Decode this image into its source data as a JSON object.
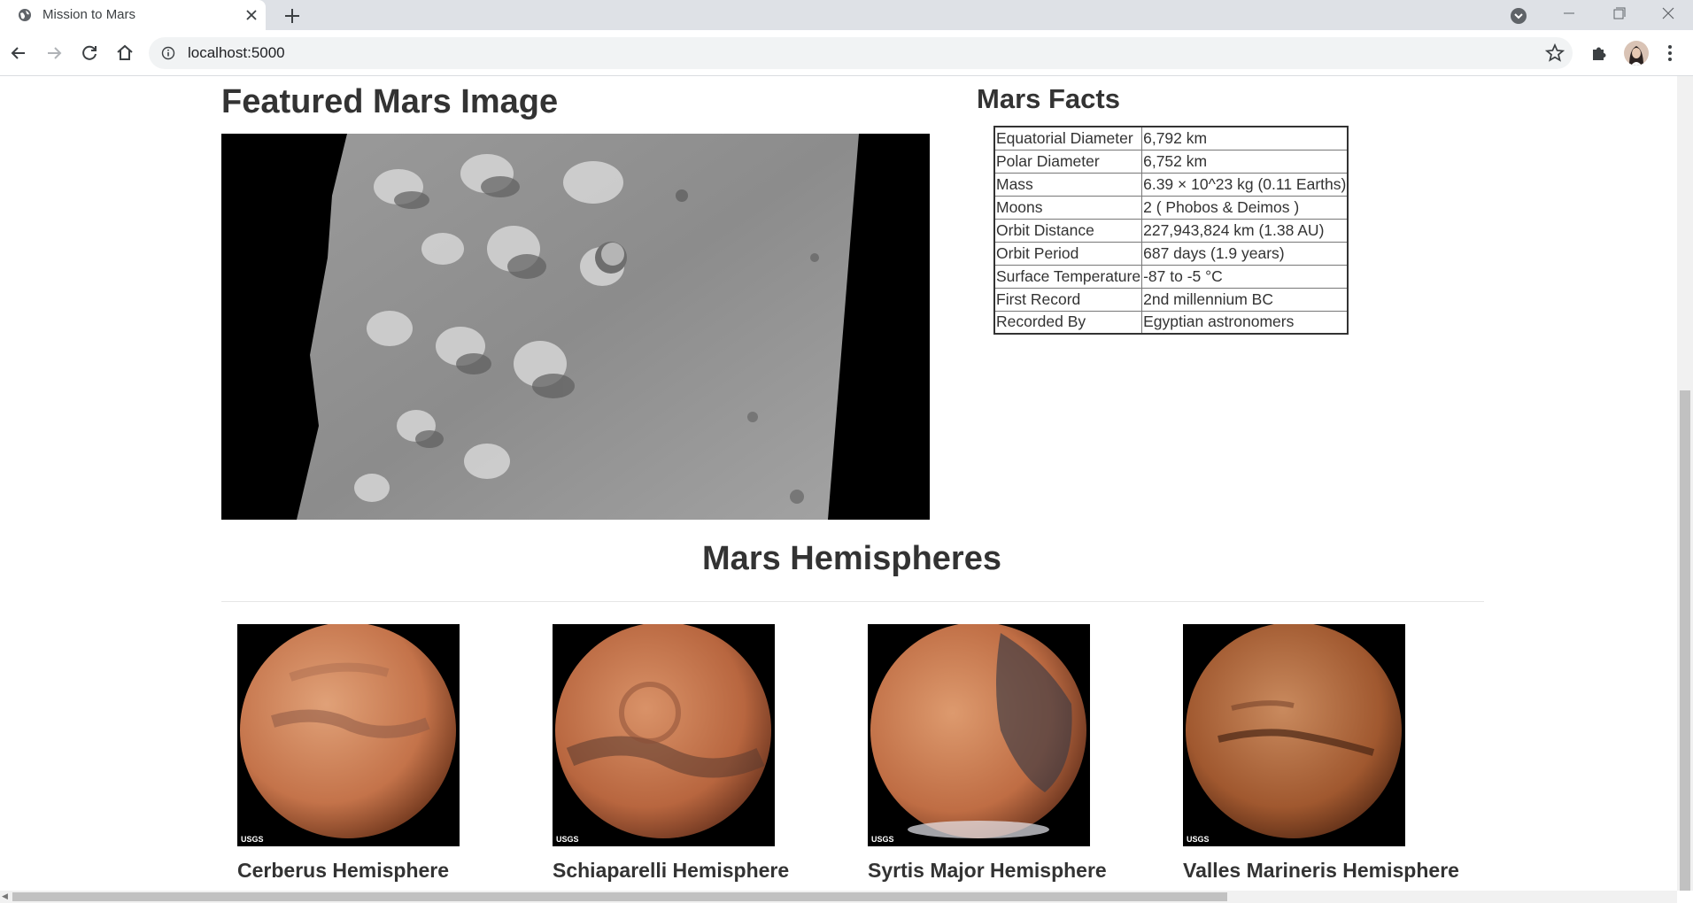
{
  "browser": {
    "tab_title": "Mission to Mars",
    "url": "localhost:5000"
  },
  "featured": {
    "title": "Featured Mars Image"
  },
  "facts": {
    "title": "Mars Facts",
    "rows": [
      {
        "label": "Equatorial Diameter",
        "value": "6,792 km"
      },
      {
        "label": "Polar Diameter",
        "value": "6,752 km"
      },
      {
        "label": "Mass",
        "value": "6.39 × 10^23 kg (0.11 Earths)"
      },
      {
        "label": "Moons",
        "value": "2 ( Phobos & Deimos )"
      },
      {
        "label": "Orbit Distance",
        "value": "227,943,824 km (1.38 AU)"
      },
      {
        "label": "Orbit Period",
        "value": "687 days (1.9 years)"
      },
      {
        "label": "Surface Temperature",
        "value": "-87 to -5 °C"
      },
      {
        "label": "First Record",
        "value": "2nd millennium BC"
      },
      {
        "label": "Recorded By",
        "value": "Egyptian astronomers"
      }
    ]
  },
  "hemispheres": {
    "title": "Mars Hemispheres",
    "items": [
      {
        "name": "Cerberus Hemisphere"
      },
      {
        "name": "Schiaparelli Hemisphere"
      },
      {
        "name": "Syrtis Major Hemisphere"
      },
      {
        "name": "Valles Marineris Hemisphere"
      }
    ],
    "image_watermark": "USGS"
  },
  "icons": {
    "tab_favicon": "globe-icon",
    "info": "info-icon",
    "bookmark": "star-icon",
    "extensions": "puzzle-icon"
  }
}
